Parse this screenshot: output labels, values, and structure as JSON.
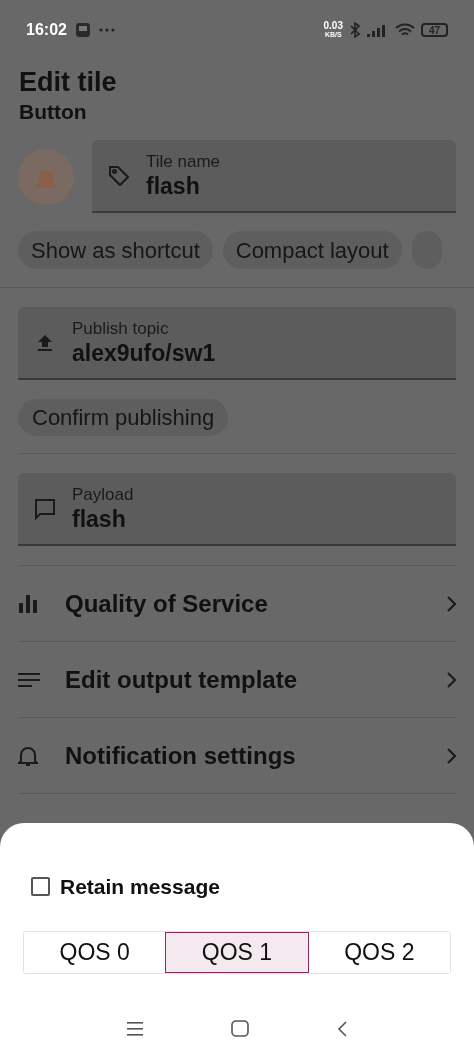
{
  "status_bar": {
    "time": "16:02",
    "speed": "0.03",
    "speed_unit": "KB/S",
    "battery": "47"
  },
  "header": {
    "title": "Edit tile",
    "subtitle": "Button"
  },
  "tile_name": {
    "label": "Tile name",
    "value": "flash"
  },
  "chips": [
    {
      "label": "Show as shortcut"
    },
    {
      "label": "Compact layout"
    }
  ],
  "publish_topic": {
    "label": "Publish topic",
    "value": "alex9ufo/sw1"
  },
  "confirm_chip": {
    "label": "Confirm publishing"
  },
  "payload": {
    "label": "Payload",
    "value": "flash"
  },
  "menu": [
    {
      "kind": "qos",
      "label": "Quality of Service"
    },
    {
      "kind": "template",
      "label": "Edit output template"
    },
    {
      "kind": "notify",
      "label": "Notification settings"
    }
  ],
  "sheet": {
    "retain": {
      "label": "Retain message",
      "checked": false
    },
    "qos_options": [
      {
        "label": "QOS 0",
        "selected": false
      },
      {
        "label": "QOS 1",
        "selected": true
      },
      {
        "label": "QOS 2",
        "selected": false
      }
    ]
  }
}
